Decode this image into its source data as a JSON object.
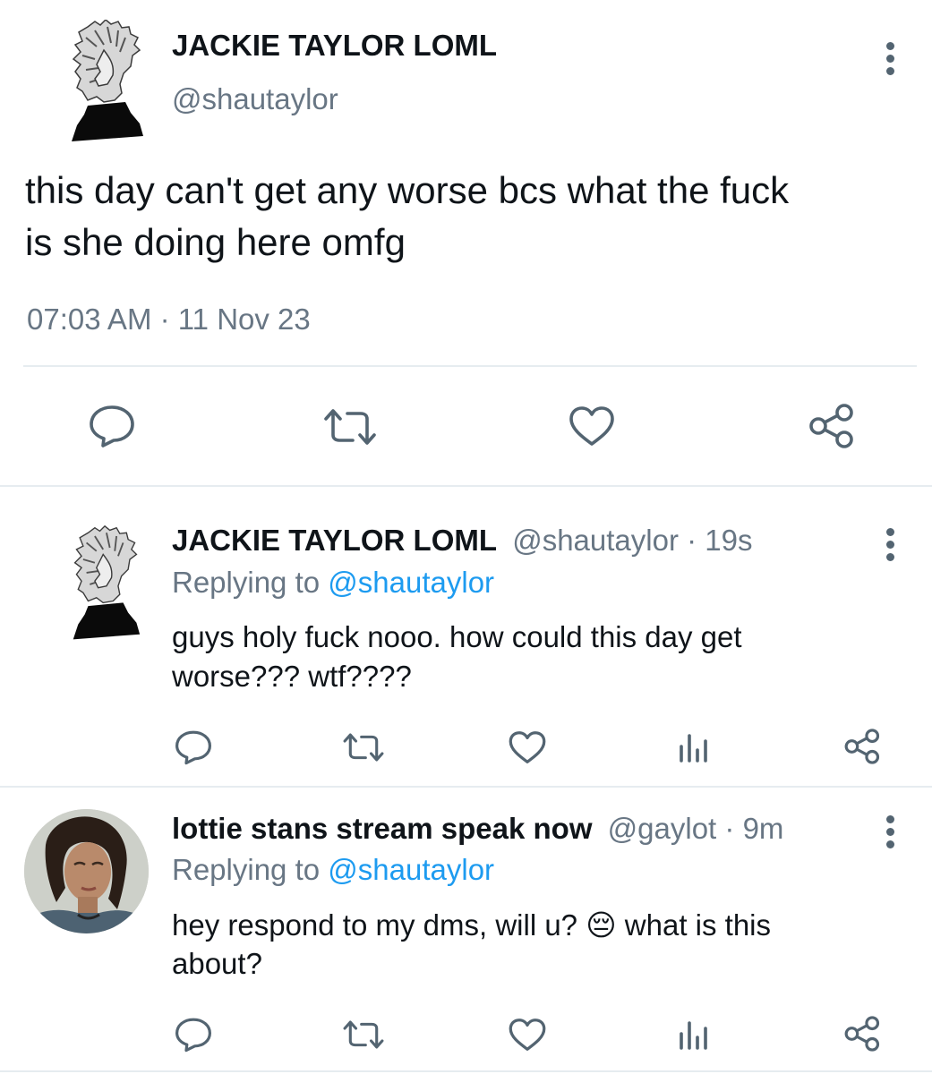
{
  "main_tweet": {
    "display_name": "JACKIE TAYLOR LOML",
    "handle": "@shautaylor",
    "text_line1": "this day can't get any worse bcs what the fuck",
    "text_line2": "is she doing here omfg",
    "time": "07:03 AM",
    "separator": "·",
    "date": "11 Nov 23",
    "actions": [
      "reply-icon",
      "retweet-icon",
      "like-icon",
      "share-icon"
    ]
  },
  "replies": [
    {
      "display_name": "JACKIE TAYLOR LOML",
      "handle": "@shautaylor",
      "time": "· 19s",
      "replying_to_label": "Replying to",
      "replying_to_handle": "@shautaylor",
      "text_line1": "guys holy fuck nooo. how could this day get",
      "text_line2": "worse??? wtf????"
    },
    {
      "display_name": "lottie stans stream speak now",
      "handle": "@gaylot",
      "time": "· 9m",
      "replying_to_label": "Replying to",
      "replying_to_handle": "@shautaylor",
      "text_line1a": "hey respond to my dms, will u?",
      "emoji": "😔",
      "text_line1b": "what is this",
      "text_line2": "about?"
    }
  ],
  "colors": {
    "text": "#0f1419",
    "secondary": "#687684",
    "link": "#1d9bf0",
    "divider": "#e6ecf0"
  }
}
